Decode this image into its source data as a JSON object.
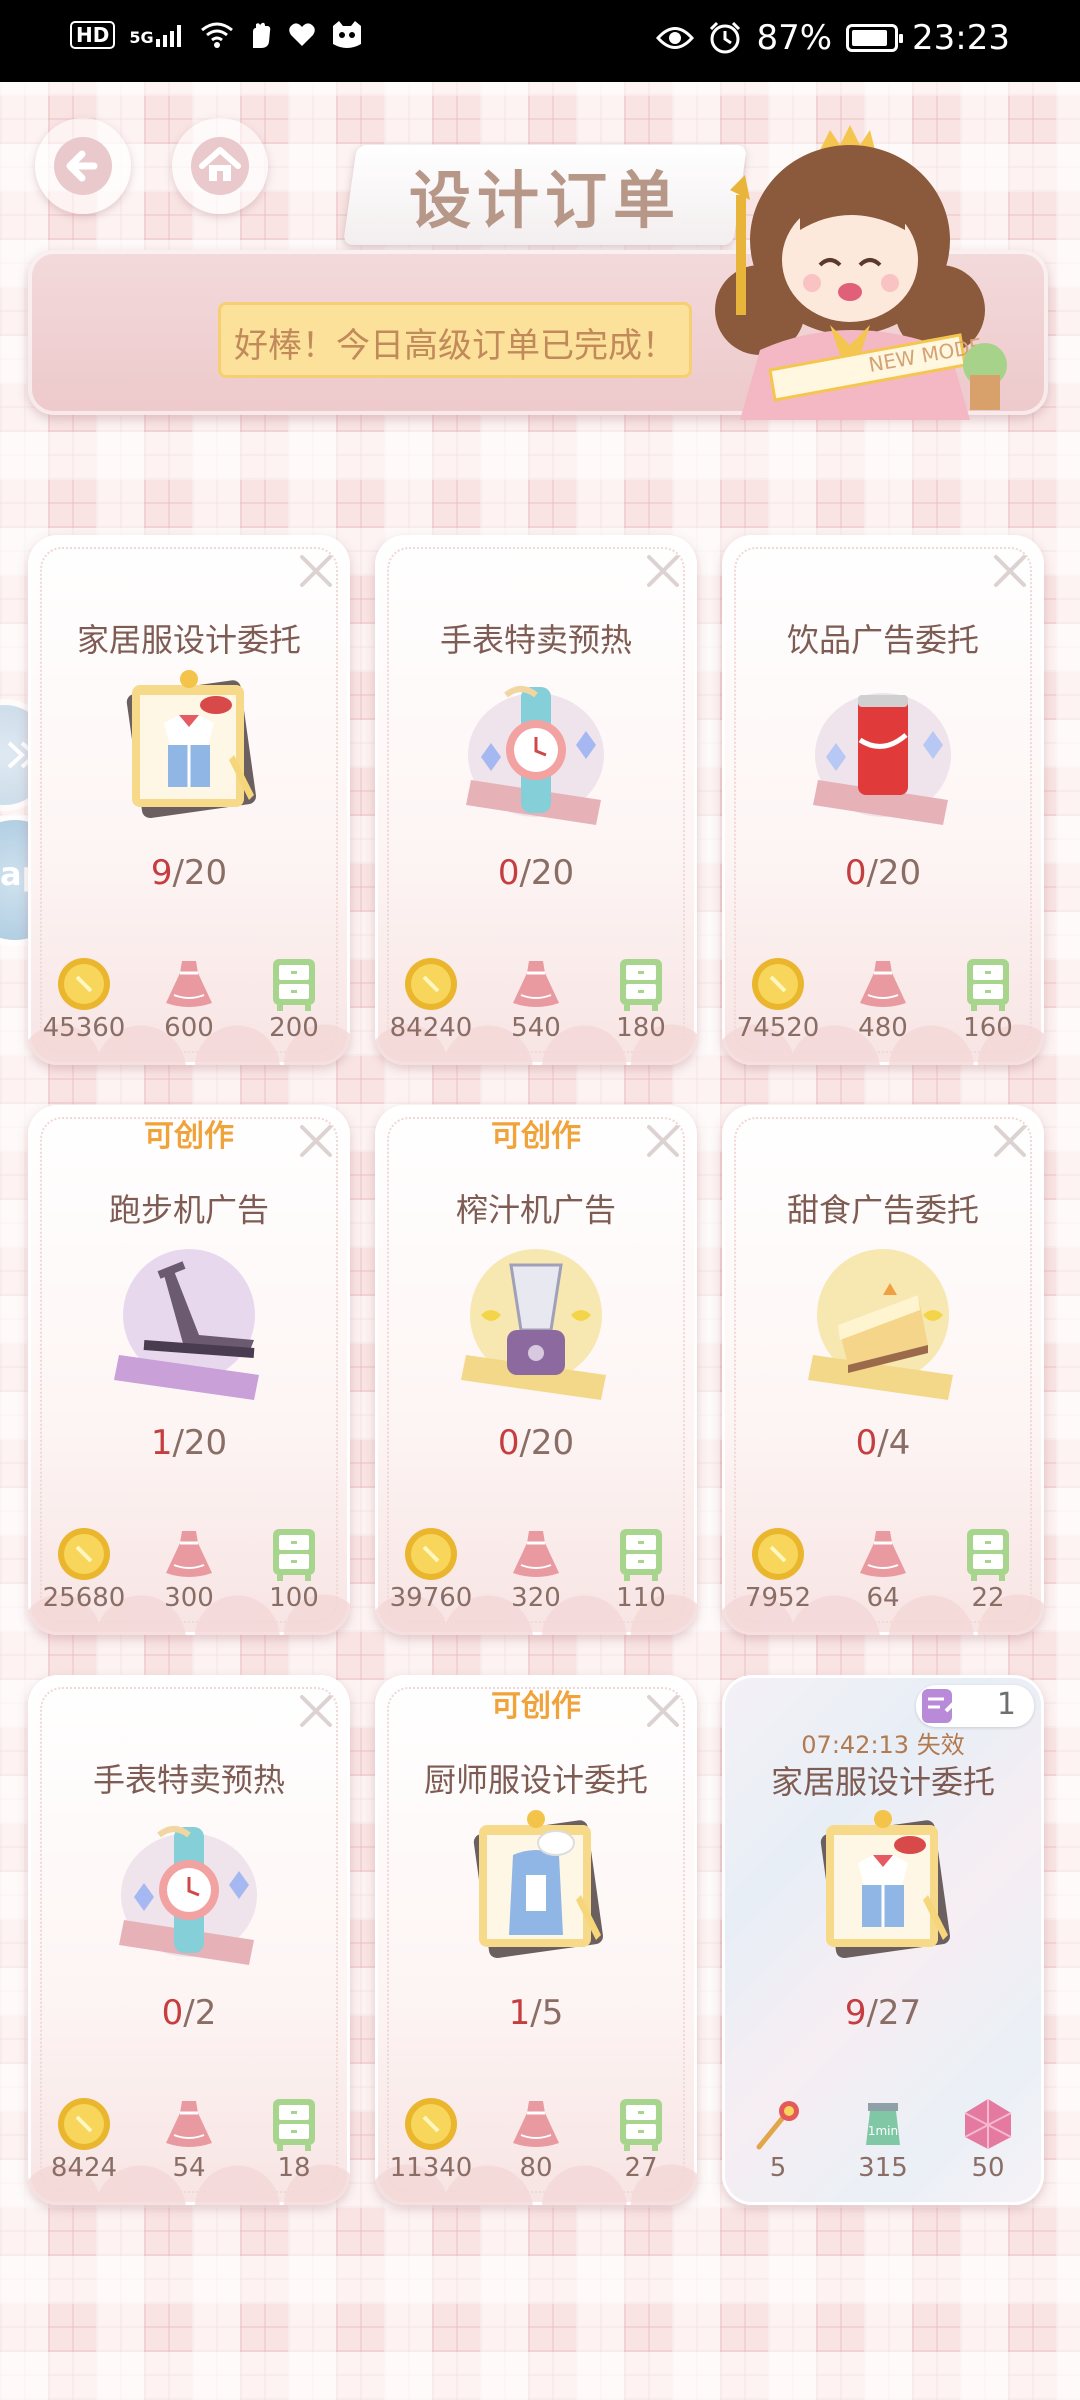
{
  "status_bar": {
    "left_icons": [
      "hd-badge-icon",
      "signal-5g-icon",
      "wifi-icon",
      "hand-icon",
      "heart-icon",
      "cat-icon"
    ],
    "hd_label": "HD",
    "network_label": "5G",
    "battery_percent": "87%",
    "battery_level": 0.87,
    "time": "23:23"
  },
  "header": {
    "title": "设计订单",
    "notice": "好棒！今日高级订单已完成！",
    "mascot_sash": "NEW MODE"
  },
  "side_tab": {
    "label": "ap"
  },
  "cards": [
    {
      "tag": "",
      "title": "家居服设计委托",
      "art": "pajama-order-icon",
      "progress_current": "9",
      "progress_total": "/20",
      "rewards": [
        {
          "icon": "coin-icon",
          "value": "45360"
        },
        {
          "icon": "dress-icon",
          "value": "600"
        },
        {
          "icon": "cabinet-icon",
          "value": "200"
        }
      ]
    },
    {
      "tag": "",
      "title": "手表特卖预热",
      "art": "watch-order-icon",
      "progress_current": "0",
      "progress_total": "/20",
      "rewards": [
        {
          "icon": "coin-icon",
          "value": "84240"
        },
        {
          "icon": "dress-icon",
          "value": "540"
        },
        {
          "icon": "cabinet-icon",
          "value": "180"
        }
      ]
    },
    {
      "tag": "",
      "title": "饮品广告委托",
      "art": "drink-order-icon",
      "progress_current": "0",
      "progress_total": "/20",
      "rewards": [
        {
          "icon": "coin-icon",
          "value": "74520"
        },
        {
          "icon": "dress-icon",
          "value": "480"
        },
        {
          "icon": "cabinet-icon",
          "value": "160"
        }
      ]
    },
    {
      "tag": "可创作",
      "title": "跑步机广告",
      "art": "treadmill-order-icon",
      "progress_current": "1",
      "progress_total": "/20",
      "rewards": [
        {
          "icon": "coin-icon",
          "value": "25680"
        },
        {
          "icon": "dress-icon",
          "value": "300"
        },
        {
          "icon": "cabinet-icon",
          "value": "100"
        }
      ]
    },
    {
      "tag": "可创作",
      "title": "榨汁机广告",
      "art": "juicer-order-icon",
      "progress_current": "0",
      "progress_total": "/20",
      "rewards": [
        {
          "icon": "coin-icon",
          "value": "39760"
        },
        {
          "icon": "dress-icon",
          "value": "320"
        },
        {
          "icon": "cabinet-icon",
          "value": "110"
        }
      ]
    },
    {
      "tag": "",
      "title": "甜食广告委托",
      "art": "cake-order-icon",
      "progress_current": "0",
      "progress_total": "/4",
      "rewards": [
        {
          "icon": "coin-icon",
          "value": "7952"
        },
        {
          "icon": "dress-icon",
          "value": "64"
        },
        {
          "icon": "cabinet-icon",
          "value": "22"
        }
      ]
    },
    {
      "tag": "",
      "title": "手表特卖预热",
      "art": "watch-order-icon",
      "progress_current": "0",
      "progress_total": "/2",
      "rewards": [
        {
          "icon": "coin-icon",
          "value": "8424"
        },
        {
          "icon": "dress-icon",
          "value": "54"
        },
        {
          "icon": "cabinet-icon",
          "value": "18"
        }
      ]
    },
    {
      "tag": "可创作",
      "title": "厨师服设计委托",
      "art": "chef-apron-order-icon",
      "progress_current": "1",
      "progress_total": "/5",
      "rewards": [
        {
          "icon": "coin-icon",
          "value": "11340"
        },
        {
          "icon": "dress-icon",
          "value": "80"
        },
        {
          "icon": "cabinet-icon",
          "value": "27"
        }
      ]
    }
  ],
  "special_card": {
    "timer": "07:42:13 失效",
    "title": "家居服设计委托",
    "badge_count": "1",
    "art": "pajama-order-icon",
    "progress_current": "9",
    "progress_total": "/27",
    "rewards": [
      {
        "icon": "wand-key-icon",
        "value": "5"
      },
      {
        "icon": "time-bottle-icon",
        "value": "315"
      },
      {
        "icon": "pink-gem-icon",
        "value": "50"
      }
    ]
  },
  "colors": {
    "progress_current": "#c53d3f",
    "tag": "#f0a33a",
    "accent_text": "#7e5c53"
  }
}
